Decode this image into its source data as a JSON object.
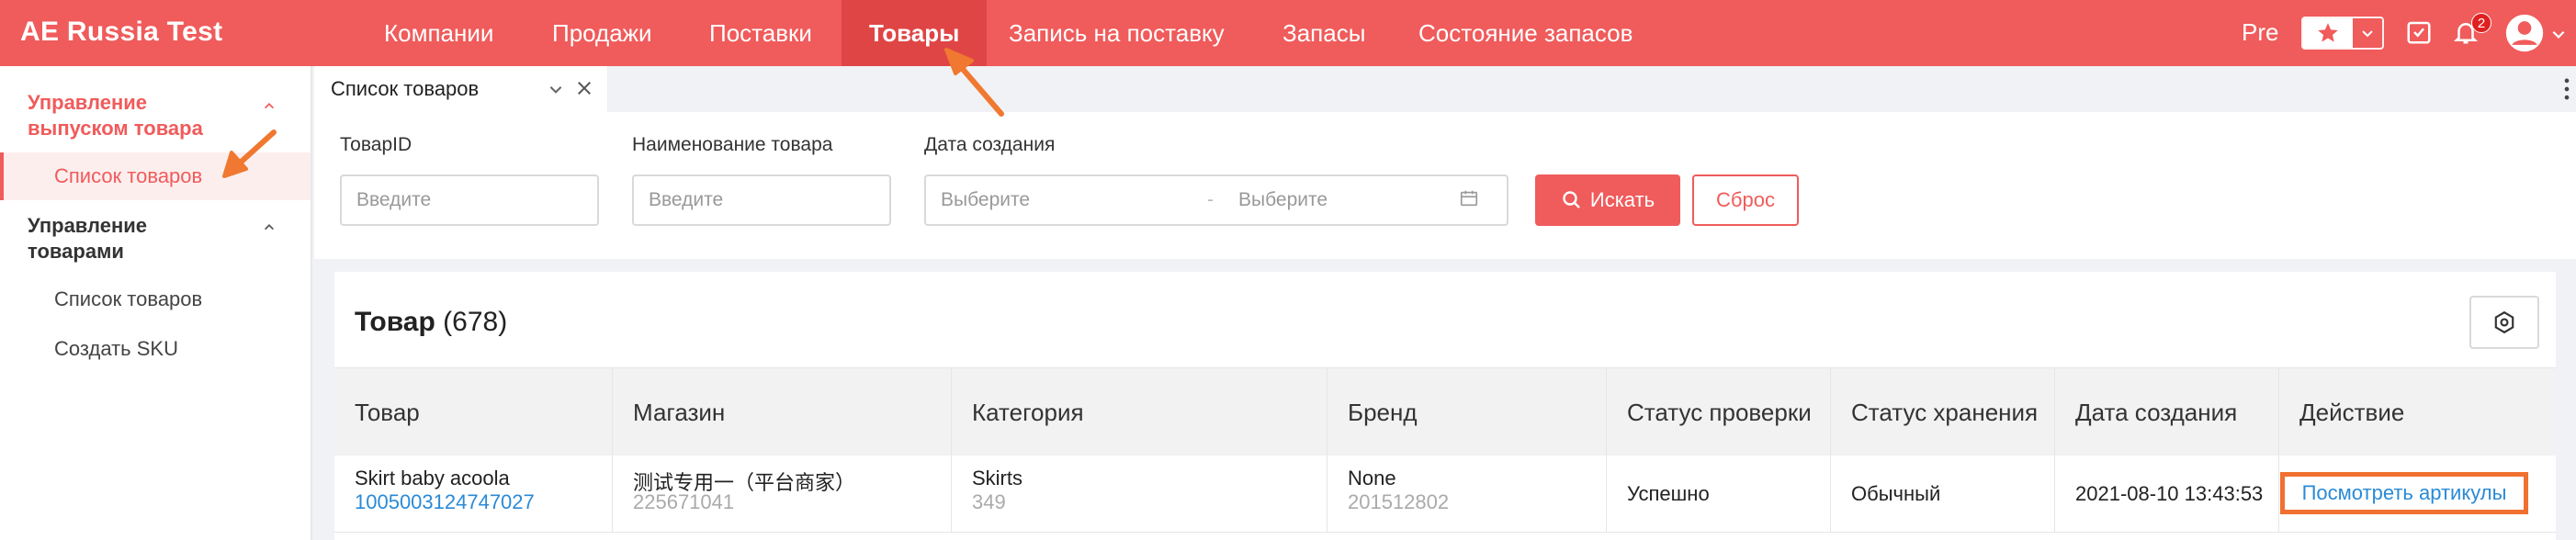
{
  "app": {
    "brand": "AE Russia Test"
  },
  "nav": {
    "items": [
      {
        "label": "Компании"
      },
      {
        "label": "Продажи"
      },
      {
        "label": "Поставки"
      },
      {
        "label": "Товары"
      },
      {
        "label": "Запись на поставку"
      },
      {
        "label": "Запасы"
      },
      {
        "label": "Состояние запасов"
      }
    ],
    "active_index": 3
  },
  "topright": {
    "env_label": "Pre",
    "notification_count": "2"
  },
  "sidebar": {
    "groups": [
      {
        "label": "Управление выпуском товара",
        "items": [
          {
            "label": "Список товаров"
          }
        ]
      },
      {
        "label": "Управление товарами",
        "items": [
          {
            "label": "Список товаров"
          },
          {
            "label": "Создать SKU"
          }
        ]
      }
    ]
  },
  "tabs": [
    {
      "label": "Список товаров"
    }
  ],
  "filters": {
    "product_id": {
      "label": "ТоварID",
      "placeholder": "Введите"
    },
    "product_name": {
      "label": "Наименование товара",
      "placeholder": "Введите"
    },
    "created": {
      "label": "Дата создания",
      "start_placeholder": "Выберите",
      "separator": "-",
      "end_placeholder": "Выберите"
    },
    "search_label": "Искать",
    "reset_label": "Сброс"
  },
  "table": {
    "title": "Товар",
    "count": "(678)",
    "columns": [
      "Товар",
      "Магазин",
      "Категория",
      "Бренд",
      "Статус проверки",
      "Статус хранения",
      "Дата создания",
      "Действие"
    ],
    "rows": [
      {
        "product_name": "Skirt baby acoola",
        "product_id": "1005003124747027",
        "store_name": "测试专用一（平台商家）",
        "store_id": "225671041",
        "category_name": "Skirts",
        "category_id": "349",
        "brand_name": "None",
        "brand_id": "201512802",
        "review_status": "Успешно",
        "storage_status": "Обычный",
        "created_at": "2021-08-10 13:43:53",
        "action": "Посмотреть артикулы"
      }
    ]
  },
  "colors": {
    "brand": "#f05b5b",
    "link": "#2a8ad6",
    "highlight": "#f07030"
  }
}
